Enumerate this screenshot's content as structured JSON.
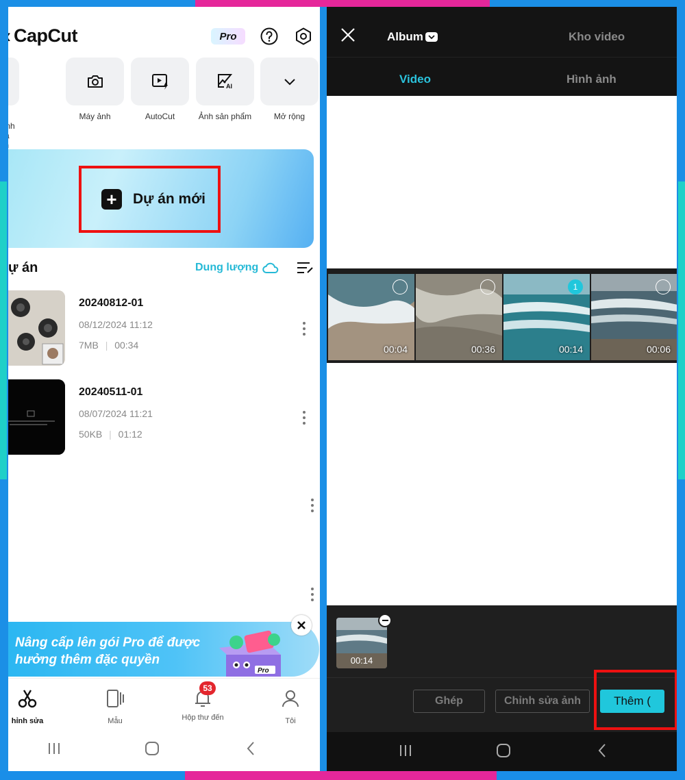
{
  "left": {
    "app_name": "CapCut",
    "pro_badge": "Pro",
    "tools": [
      {
        "label": "h chỉnh sửa\nảnh",
        "icon": "photo-edit-icon"
      },
      {
        "label": "Máy ảnh",
        "icon": "camera-icon"
      },
      {
        "label": "AutoCut",
        "icon": "autocut-icon"
      },
      {
        "label": "Ảnh sản phẩm",
        "icon": "ai-image-icon"
      },
      {
        "label": "Mở rộng",
        "icon": "chevron-down-icon"
      }
    ],
    "new_project_label": "Dự án mới",
    "projects_title": "ự án",
    "storage_label": "Dung lượng",
    "projects": [
      {
        "name": "20240812-01",
        "date": "08/12/2024 11:12",
        "size": "7MB",
        "duration": "00:34"
      },
      {
        "name": "20240511-01",
        "date": "08/07/2024 11:21",
        "size": "50KB",
        "duration": "01:12"
      }
    ],
    "promo_text": "Nâng cấp lên gói Pro để được hưởng thêm đặc quyền",
    "promo_pro": "Pro",
    "nav": [
      {
        "label": "hỉnh sửa",
        "icon": "scissors-icon",
        "active": true
      },
      {
        "label": "Mẫu",
        "icon": "template-icon",
        "active": false
      },
      {
        "label": "Hộp thư đến",
        "icon": "bell-icon",
        "active": false,
        "badge": "53"
      },
      {
        "label": "Tôi",
        "icon": "profile-icon",
        "active": false
      }
    ]
  },
  "right": {
    "album_label": "Album",
    "kho_video_label": "Kho video",
    "tabs": [
      "Video",
      "Hình ảnh"
    ],
    "active_tab": "Video",
    "clips": [
      {
        "duration": "00:04",
        "selected": false,
        "order": ""
      },
      {
        "duration": "00:36",
        "selected": false,
        "order": ""
      },
      {
        "duration": "00:14",
        "selected": true,
        "order": "1"
      },
      {
        "duration": "00:06",
        "selected": false,
        "order": ""
      }
    ],
    "tray": [
      {
        "duration": "00:14"
      }
    ],
    "buttons": {
      "merge": "Ghép",
      "edit_photo": "Chỉnh sửa ảnh",
      "add": "Thêm ("
    }
  },
  "colors": {
    "accent": "#20c7dc",
    "highlight": "#ee1111",
    "frame_blue": "#1b8fe6",
    "frame_pink": "#e5279a",
    "frame_teal": "#1fd0c8"
  }
}
